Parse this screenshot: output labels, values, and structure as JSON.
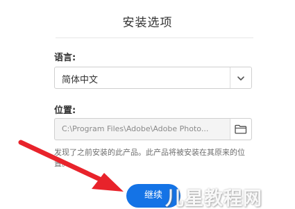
{
  "dialog": {
    "title": "安装选项"
  },
  "language": {
    "label": "语言:",
    "selected": "简体中文",
    "dropdown_icon": "chevron-down-icon"
  },
  "location": {
    "label": "位置:",
    "value": "C:\\Program Files\\Adobe\\Adobe Photo...",
    "browse_icon": "folder-icon"
  },
  "note": "发现了之前安装的此产品。此产品将被安装在其原来的位置。",
  "buttons": {
    "continue": "继续"
  },
  "overlay": {
    "arrow_color": "#e8232b",
    "watermark": "儿星教程网"
  },
  "colors": {
    "accent": "#1473e6"
  }
}
